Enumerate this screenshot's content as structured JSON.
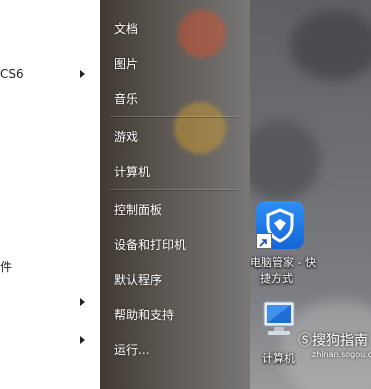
{
  "left_list": {
    "items": [
      {
        "label": "CS6",
        "has_arrow": true
      },
      {
        "label": "件",
        "has_arrow": false
      },
      {
        "label": "",
        "has_arrow": true
      },
      {
        "label": "",
        "has_arrow": true
      }
    ]
  },
  "start_menu": {
    "items": [
      {
        "label": "文档"
      },
      {
        "label": "图片"
      },
      {
        "label": "音乐"
      },
      {
        "label": "游戏"
      },
      {
        "label": "计算机"
      },
      {
        "label": "控制面板"
      },
      {
        "label": "设备和打印机"
      },
      {
        "label": "默认程序"
      },
      {
        "label": "帮助和支持"
      },
      {
        "label": "运行..."
      }
    ]
  },
  "desktop": {
    "shortcut_line1": "电脑管家 - 快",
    "shortcut_line2": "捷方式",
    "computer_label": "计算机",
    "accent_color": "#1e7be8"
  },
  "watermark": {
    "text": "搜狗指南",
    "subtext": "zhinan.sogou.com"
  }
}
